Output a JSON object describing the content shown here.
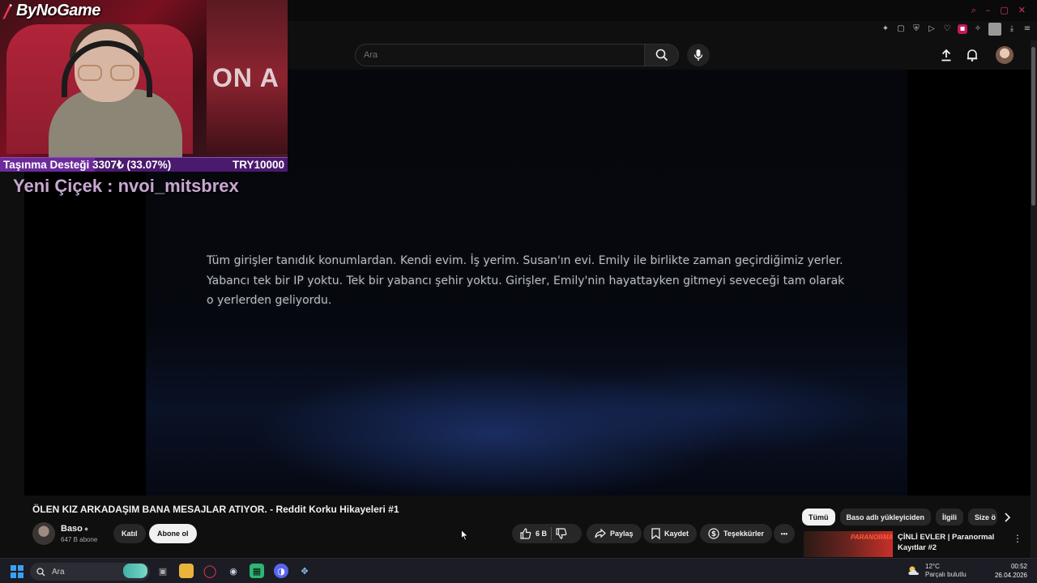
{
  "browser": {
    "window_controls": [
      "⌕",
      "–",
      "▢",
      "✕"
    ],
    "extension_icons": [
      "pin-icon",
      "tab-icon",
      "shield-icon",
      "play-icon",
      "heart-icon",
      "twitch-icon",
      "puzzle-icon",
      "profile-icon",
      "download-icon",
      "menu-icon"
    ]
  },
  "header": {
    "search_placeholder": "Ara"
  },
  "stream_overlay": {
    "logo": "ByNoGame",
    "wall_text": "ON A",
    "support_label": "Taşınma Desteği 3307₺ (33.07%)",
    "support_goal": "TRY10000",
    "support_progress": 0.3307,
    "flower_alert": "Yeni Çiçek : nvoi_mitsbrex"
  },
  "video": {
    "subtitle": "Tüm girişler tanıdık konumlardan. Kendi evim. İş yerim. Susan'ın evi. Emily ile birlikte zaman geçirdiğimiz yerler. Yabancı tek bir IP yoktu. Tek bir yabancı şehir yoktu. Girişler, Emily'nin hayattayken gitmeyi seveceği tam olarak o yerlerden geliyordu."
  },
  "info": {
    "title": "ÖLEN KIZ ARKADAŞIM BANA MESAJLAR ATIYOR. - Reddit Korku Hikayeleri #1",
    "channel_name": "Baso",
    "subscribers": "647 B abone",
    "join_label": "Katıl",
    "subscribe_label": "Abone ol",
    "like_count": "6 B",
    "share_label": "Paylaş",
    "save_label": "Kaydet",
    "thanks_label": "Teşekkürler",
    "more_label": "•••"
  },
  "sidebar": {
    "chips": [
      "Tümü",
      "Baso adlı yükleyiciden",
      "İlgili",
      "Size ö"
    ],
    "recommendation": {
      "title": "ÇİNLİ EVLER | Paranormal Kayıtlar #2",
      "thumb_tag": "PARANORMAL"
    }
  },
  "taskbar": {
    "search_label": "Ara",
    "weather_temp": "12°C",
    "weather_desc": "Parçalı bulutlu",
    "time": "00:52",
    "date": "26.04.2026"
  },
  "colors": {
    "accent_red": "#ff0000",
    "overlay_purple": "#4a1a6e",
    "flower_text": "#c9a7d2"
  }
}
